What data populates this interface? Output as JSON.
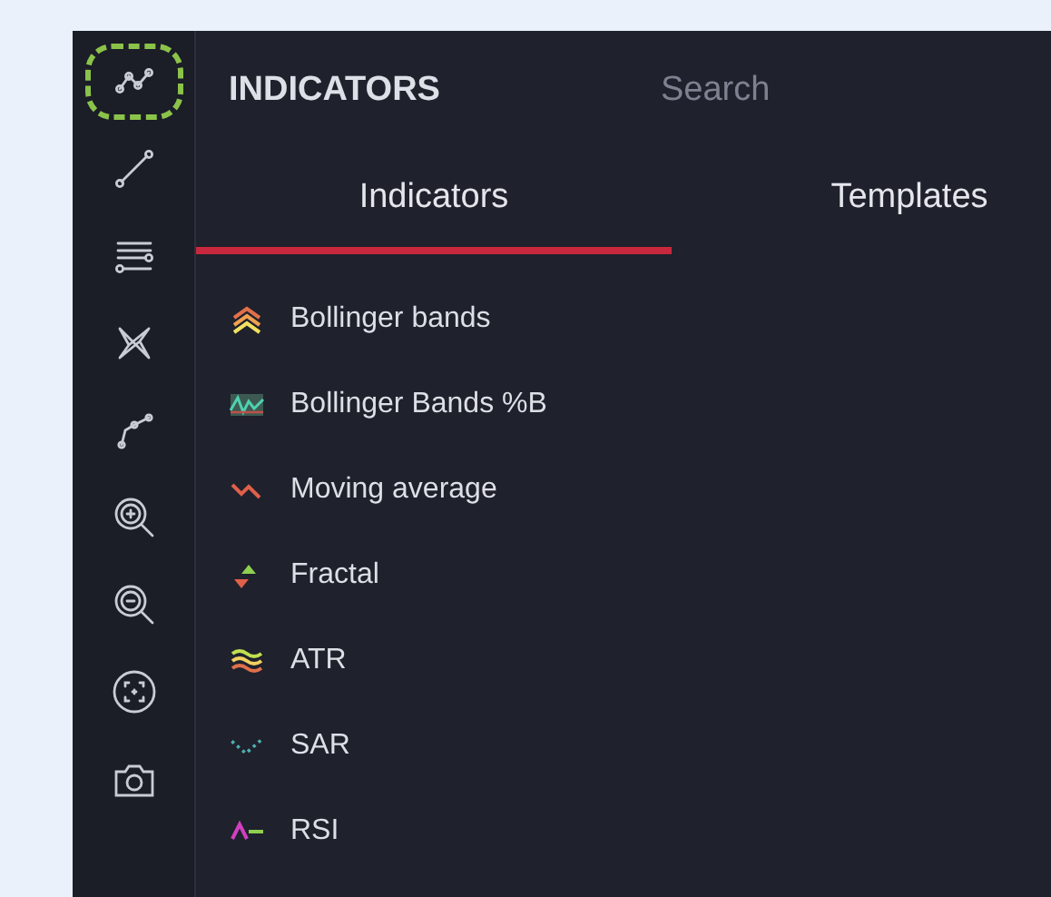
{
  "toolbar": {
    "tools": [
      {
        "selected": true
      },
      {
        "selected": false
      },
      {
        "selected": false
      },
      {
        "selected": false
      },
      {
        "selected": false
      },
      {
        "selected": false
      },
      {
        "selected": false
      },
      {
        "selected": false
      },
      {
        "selected": false
      }
    ]
  },
  "panel": {
    "title": "INDICATORS",
    "search": {
      "placeholder": "Search"
    },
    "tabs": [
      {
        "label": "Indicators",
        "selected": true
      },
      {
        "label": "Templates",
        "selected": false
      }
    ],
    "indicators": [
      {
        "kind": "bands",
        "name": "Bollinger bands"
      },
      {
        "kind": "percentb",
        "name": "Bollinger Bands %B"
      },
      {
        "kind": "ma",
        "name": "Moving average"
      },
      {
        "kind": "fractal",
        "name": "Fractal"
      },
      {
        "kind": "atr",
        "name": "ATR"
      },
      {
        "kind": "sar",
        "name": "SAR"
      },
      {
        "kind": "rsi",
        "name": "RSI"
      }
    ]
  }
}
